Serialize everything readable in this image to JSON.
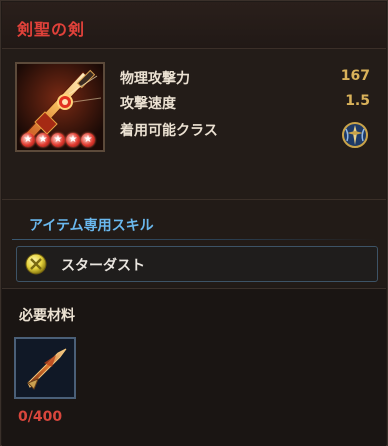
{
  "title": "剣聖の剣",
  "item": {
    "icon": "sword-icon",
    "rarity_stars": 5,
    "stats": [
      {
        "label": "物理攻撃力",
        "value": "167"
      },
      {
        "label": "攻撃速度",
        "value": "1.5"
      },
      {
        "label": "着用可能クラス",
        "value": ""
      }
    ],
    "class_icon": "knight-class-emblem-icon"
  },
  "skill": {
    "heading": "アイテム専用スキル",
    "name": "スターダスト",
    "icon": "star-orb-icon"
  },
  "materials": {
    "heading": "必要材料",
    "icon": "weapon-shard-icon",
    "count": "0/400"
  },
  "colors": {
    "title": "#e0413a",
    "skill_heading": "#6ab8ee",
    "value": "#d9b25a",
    "count": "#d8463c"
  }
}
